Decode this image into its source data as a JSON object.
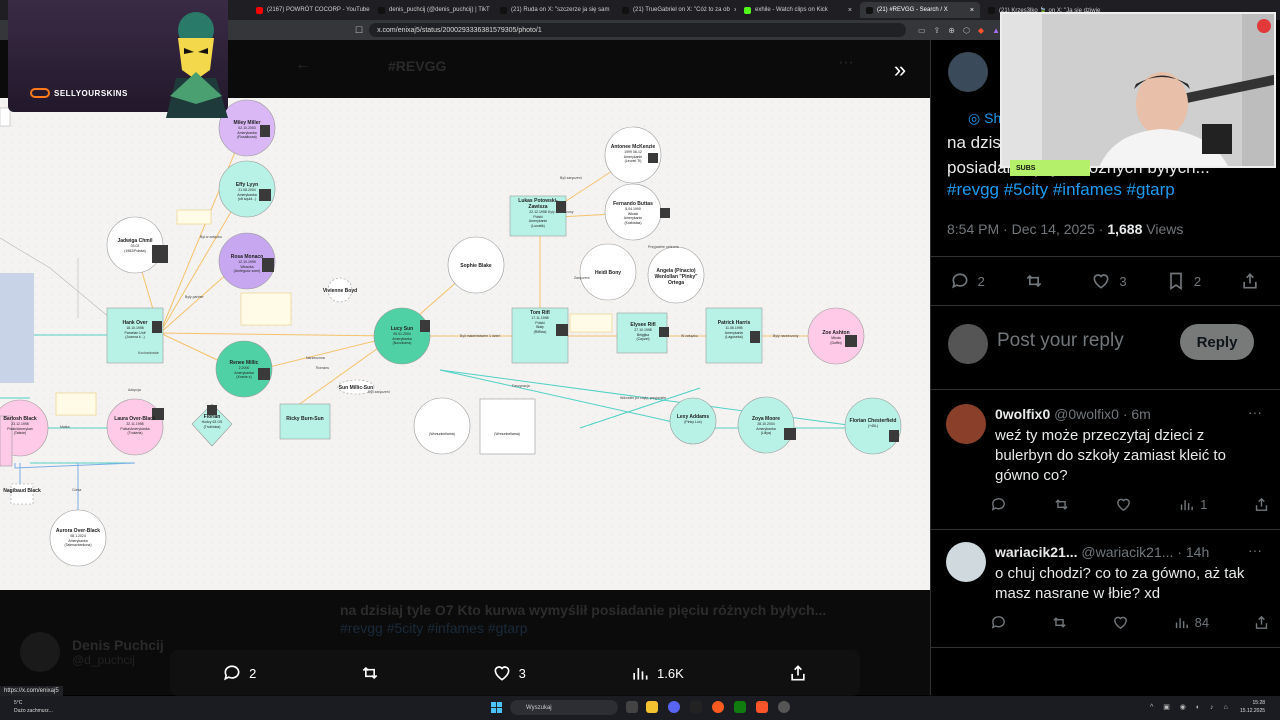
{
  "browser": {
    "tabs": [
      {
        "label": "(2167) POWRÓT COCORP - YouTube",
        "color": "#ff0000",
        "icon": "youtube-icon",
        "active": false
      },
      {
        "label": "denis_puchcij (@denis_puchcij) | TikT",
        "color": "#111111",
        "icon": "tiktok-icon",
        "active": false
      },
      {
        "label": "(21) Ruda on X: \"szczerze ja się sam",
        "color": "#111111",
        "icon": "x-icon",
        "active": false
      },
      {
        "label": "(21) TrueGabriel on X: \"Cóż to za ob",
        "color": "#111111",
        "icon": "x-icon",
        "active": false
      },
      {
        "label": "exhile - Watch clips on Kick",
        "color": "#53fc18",
        "icon": "kick-icon",
        "active": false
      },
      {
        "label": "(21) #REVGG - Search / X",
        "color": "#111111",
        "icon": "x-icon",
        "active": true
      },
      {
        "label": "(21) Krzes3lko 🍃 on X: \"Ja się dziwię",
        "color": "#111111",
        "icon": "x-icon",
        "active": false
      }
    ],
    "url": "x.com/enixaj5/status/2000293336381579305/photo/1",
    "status_url": "https://x.com/enixaj5"
  },
  "overlay": {
    "sponsor": "SELLYOURSKINS",
    "subs_label": "SUBS"
  },
  "photo_view": {
    "header_title": "#REVGG",
    "ghost_text": "na dzisiaj tyle O7 Kto kurwa wymyślił posiadanie pięciu różnych byłych...",
    "ghost_tags": "#revgg #5city #infames #gtarp",
    "ghost_author_name": "Denis Puchcij",
    "ghost_author_handle": "@d_puchcij",
    "actions": {
      "replies": "2",
      "reposts": "",
      "likes": "3",
      "views": "1.6K"
    }
  },
  "diagram": {
    "nodes": [
      {
        "label": "Miley Miller",
        "sub": "02.10.2003\nAmerykanka\n(Rusałkowa)",
        "color": "#d9b8f5"
      },
      {
        "label": "Effy Lyyn",
        "sub": "21.08.2004\nAmerykanka\n(n8 squid...)",
        "color": "#b8f2e6"
      },
      {
        "label": "Jadwiga Chmil",
        "sub": "03.03\n(1982/Polska)",
        "color": "#ffffff"
      },
      {
        "label": "Rosa Monaco",
        "sub": "12.10.1999\nWłoszka\n(Amfeguoz zone)",
        "color": "#c7a7f0"
      },
      {
        "label": "Hank Over",
        "sub": "18.10.1998\nPamelan Unif\n(Joanna k...)",
        "color": "#b8f2e6"
      },
      {
        "label": "Renee Millic",
        "sub": "2.2000\nAmerykanka\n(Kranie x)",
        "color": "#4fd1a5"
      },
      {
        "label": "Barlosh Black",
        "sub": "23.12.1998\nPolak/Amerykan\n(Tatinie)",
        "color": "#ffc9e8"
      },
      {
        "label": "Laura Over-Black",
        "sub": "22.11.1998\nPolka/Amerykanka\n(Trukena)",
        "color": "#ffc9e8"
      },
      {
        "label": "Florian",
        "sub": "Hodcy 63 GS\n(Trukhoka)",
        "color": "#b8f2e6"
      },
      {
        "label": "Ricky Burn-Sun",
        "sub": "",
        "color": "#b8f2e6"
      },
      {
        "label": "Aurora Over-Black",
        "sub": "08.1.2024\nAmerykanka\n(Talenazbarkona)",
        "color": "#ffffff"
      },
      {
        "label": "Lucy Sun",
        "sub": "05.01.2004\nAmerykanka\n(Noczkoma)",
        "color": "#4fd1a5"
      },
      {
        "label": "Vivienne Boyd",
        "sub": "",
        "color": "#ffffff"
      },
      {
        "label": "Sun Millic-Sun",
        "sub": "",
        "color": "#ffffff"
      },
      {
        "label": "Sophie Blake",
        "sub": "",
        "color": "#ffffff"
      },
      {
        "label": "Lukas Potowski-Zawisza",
        "sub": "22.12.1998\nPolski\nAmerykanin\n(Lunatik)",
        "color": "#b8f2e6"
      },
      {
        "label": "Antonee McKenzie",
        "sub": "1999 06-12\nAmerykanin\n(Leonel Tt)",
        "color": "#ffffff"
      },
      {
        "label": "Fernando Buttas",
        "sub": "5.04.1990\nWłoski\nAmerykanin\n(Krabiatas)",
        "color": "#ffffff"
      },
      {
        "label": "Heidi Bony",
        "sub": "",
        "color": "#ffffff"
      },
      {
        "label": "Angela (Pinacio) Wenlollan \"Pinky\" Ortega",
        "sub": "",
        "color": "#ffffff"
      },
      {
        "label": "Tom Rifl",
        "sub": "17.11.1998\nPolski\nBiały\n(Rifflow)",
        "color": "#b8f2e6"
      },
      {
        "label": "Elysee Rifl",
        "sub": "27.10.1998\nBelgijka\n(Cayzel)",
        "color": "#b8f2e6"
      },
      {
        "label": "Patrick Harris",
        "sub": "11.06.1995\nAmerykanin\n(Laguseka)",
        "color": "#b8f2e6"
      },
      {
        "label": "Zoe Ashton",
        "sub": "Młoda\n(Duffin)",
        "color": "#ffc9e8"
      },
      {
        "label": "Lexy Addams",
        "sub": "(Pinky Lux)",
        "color": "#b8f2e6"
      },
      {
        "label": "Zoya Moore",
        "sub": "28.10.2004\nAmerykanka\n(Liliya)",
        "color": "#b8f2e6"
      },
      {
        "label": "Florian Chesterfield",
        "sub": "(+45L)",
        "color": "#b8f2e6"
      },
      {
        "label": "",
        "sub": "(Wnnunbeliama)",
        "color": "#ffffff"
      },
      {
        "label": "",
        "sub": "(Wnnunbeliama)",
        "color": "#ffffff"
      },
      {
        "label": "Nagibaud Black",
        "sub": "",
        "color": "#ffffff"
      }
    ],
    "edge_labels": [
      "Był w związku",
      "Narzeczona",
      "Byli zaręczeni",
      "Były partner",
      "Byli małżeństwem 1 dzień",
      "Kochankowie",
      "W związku",
      "Były narzeczony",
      "Romans",
      "Fascynacja",
      "Byli zaręczeni",
      "Zaręczeni",
      "Matka",
      "Córka",
      "Adopcja",
      "Były narzeczony",
      "Wdowiec po ciąży, przyjaciele",
      "Przyjaciele ochrona"
    ]
  },
  "tweet": {
    "show_link": "Show",
    "text": "na dzisiaj tyle O7 Kto kurwa wymyślił posiadanie pięciu różnych byłych...",
    "hashtags": "#revgg #5city #infames #gtarp",
    "time": "8:54 PM · Dec 14, 2025",
    "views_count": "1,688",
    "views_label": "Views",
    "replies": "2",
    "reposts": "",
    "likes": "3",
    "bookmarks": "2"
  },
  "reply_box": {
    "placeholder": "Post your reply",
    "button": "Reply"
  },
  "comments": [
    {
      "name": "0wolfix0",
      "handle": "@0wolfix0",
      "time": "· 6m",
      "text": "weź ty może przeczytaj dzieci z bulerbyn do szkoły zamiast kleić to gówno co?",
      "views": "1",
      "avatar_color": "#8a3f2a"
    },
    {
      "name": "wariacik21...",
      "handle": "@wariacik21...",
      "time": "· 14h",
      "text": "o chuj chodzi? co to za gówno, aż tak masz nasrane w łbie? xd",
      "views": "84",
      "avatar_color": "#cfd9de"
    }
  ],
  "taskbar": {
    "search_placeholder": "Wyszukaj",
    "weather_temp": "5°C",
    "weather_desc": "Dużo zachmurz...",
    "time": "15:28",
    "date": "15.12.2025"
  }
}
